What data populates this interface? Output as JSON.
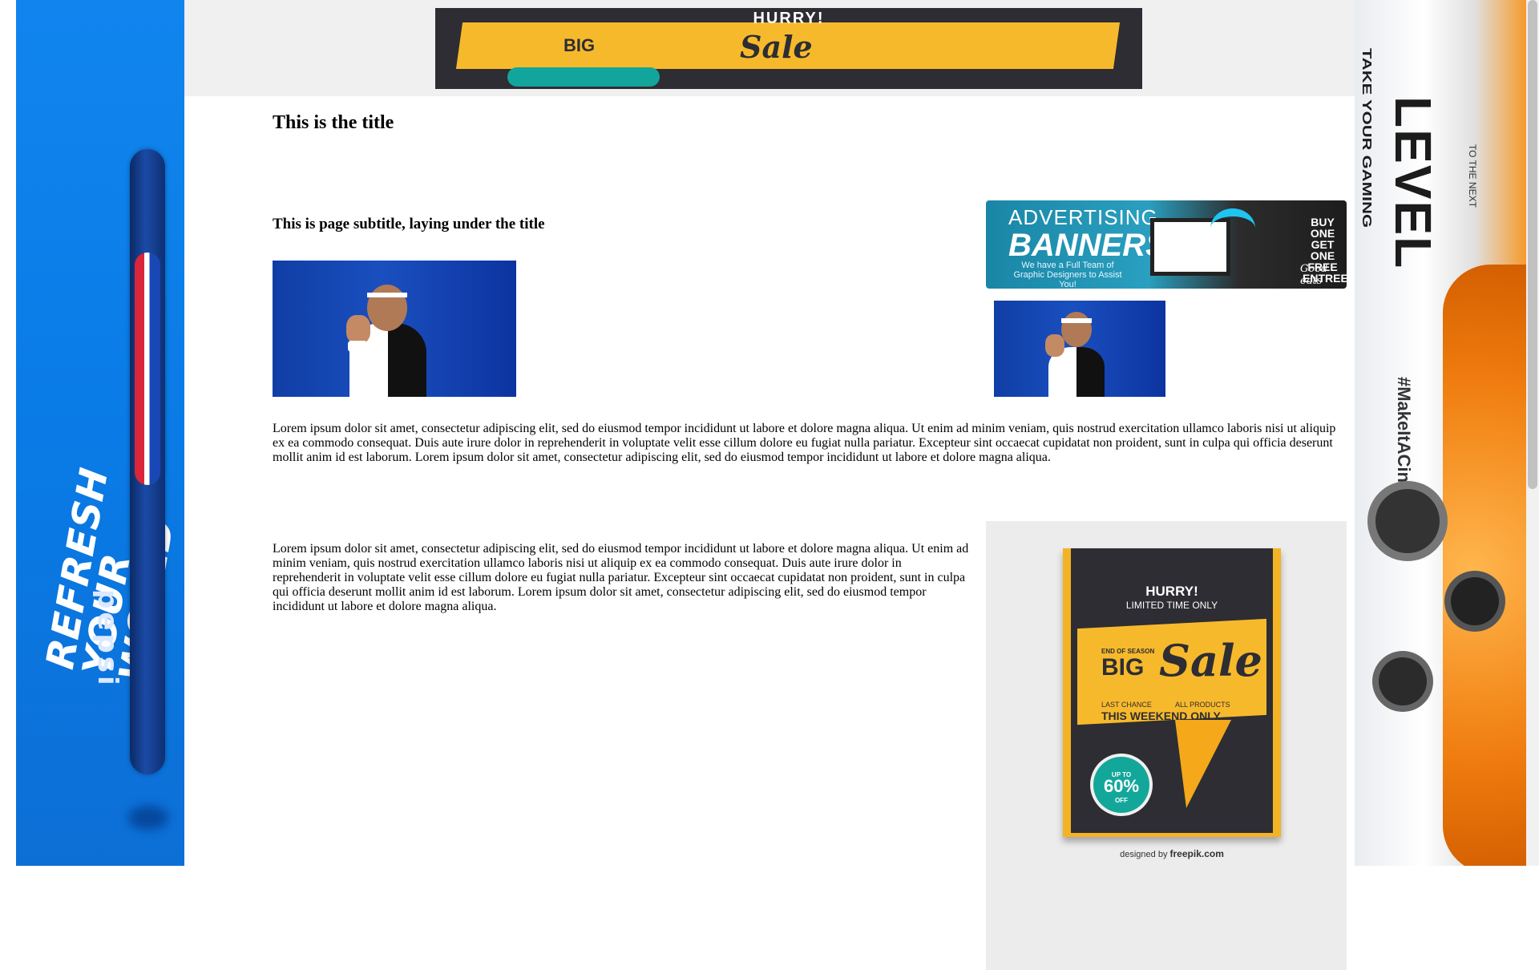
{
  "page": {
    "title": "This is the title",
    "subtitle": "This is page subtitle, laying under the title",
    "paragraph_1": "Lorem ipsum dolor sit amet, consectetur adipiscing elit, sed do eiusmod tempor incididunt ut labore et dolore magna aliqua. Ut enim ad minim veniam, quis nostrud exercitation ullamco laboris nisi ut aliquip ex ea commodo consequat. Duis aute irure dolor in reprehenderit in voluptate velit esse cillum dolore eu fugiat nulla pariatur. Excepteur sint occaecat cupidatat non proident, sunt in culpa qui officia deserunt mollit anim id est laborum. Lorem ipsum dolor sit amet, consectetur adipiscing elit, sed do eiusmod tempor incididunt ut labore et dolore magna aliqua.",
    "paragraph_2": "Lorem ipsum dolor sit amet, consectetur adipiscing elit, sed do eiusmod tempor incididunt ut labore et dolore magna aliqua. Ut enim ad minim veniam, quis nostrud exercitation ullamco laboris nisi ut aliquip ex ea commodo consequat. Duis aute irure dolor in reprehenderit in voluptate velit esse cillum dolore eu fugiat nulla pariatur. Excepteur sint occaecat cupidatat non proident, sunt in culpa qui officia deserunt mollit anim id est laborum. Lorem ipsum dolor sit amet, consectetur adipiscing elit, sed do eiusmod tempor incididunt ut labore et dolore magna aliqua."
  },
  "ads": {
    "left_skyscraper": {
      "brand": "pepsi",
      "slogan": "REFRESH\nYOUR\nWORLD",
      "colors": {
        "background": "#0a7be6",
        "can": "#0b2a66",
        "logo_red": "#d9263a"
      }
    },
    "right_skyscraper": {
      "headline": "TAKE YOUR GAMING",
      "headline_big": "LEVEL",
      "headline_suffix": "TO THE NEXT",
      "hashtag": "#MakeItACinch",
      "colors": {
        "accent": "#f07d0f"
      }
    },
    "top_leaderboard": {
      "hurry": "HURRY!",
      "big": "BIG",
      "sale": "Sale",
      "colors": {
        "background": "#2d2d33",
        "yellow": "#f7b92c",
        "badge": "#12a59b"
      }
    },
    "advertising_banner": {
      "line1": "ADVERTISING",
      "line2": "BANNERS",
      "tagline": "We have a Full Team of Graphic Designers to Assist You!",
      "offer": "BUY ONE GET ONE FREE ENTREES",
      "signature": "Good eats"
    },
    "sale_flyer": {
      "hurry": "HURRY!",
      "limited": "LIMITED TIME ONLY",
      "season": "END OF SEASON",
      "big": "BIG",
      "sale": "Sale",
      "last_chance": "LAST CHANCE",
      "all_products": "ALL PRODUCTS",
      "weekend": "THIS WEEKEND ONLY",
      "up_to": "UP TO",
      "percent": "60%",
      "off": "OFF",
      "credit_prefix": "designed by",
      "credit_brand": "freepik.com",
      "colors": {
        "yellow": "#f4b324",
        "dark": "#2d2d33",
        "badge": "#13a79a"
      }
    }
  },
  "photos": [
    {
      "subject": "tennis-player-fist-pump",
      "variant": "large"
    },
    {
      "subject": "tennis-player-fist-pump",
      "variant": "small"
    }
  ]
}
